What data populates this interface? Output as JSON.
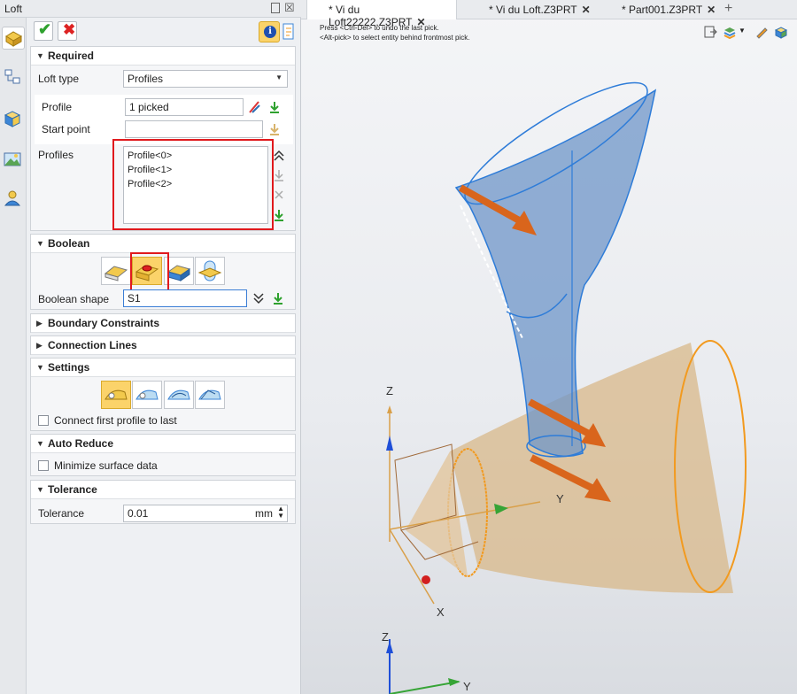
{
  "panel": {
    "title": "Loft",
    "pin_icon": "pin-icon",
    "close_glyph": "☒"
  },
  "actions": {
    "ok": "✔",
    "cancel": "✖",
    "info": "i"
  },
  "required": {
    "header": "Required",
    "loft_type_label": "Loft type",
    "loft_type_value": "Profiles",
    "profile_label": "Profile",
    "profile_value": "1 picked",
    "start_point_label": "Start point",
    "start_point_value": "",
    "profiles_label": "Profiles",
    "profiles_list": [
      "Profile<0>",
      "Profile<1>",
      "Profile<2>"
    ]
  },
  "boolean": {
    "header": "Boolean",
    "shape_label": "Boolean shape",
    "shape_value": "S1"
  },
  "boundary": {
    "header": "Boundary Constraints"
  },
  "connection": {
    "header": "Connection Lines"
  },
  "settings": {
    "header": "Settings",
    "connect_label": "Connect first profile to last"
  },
  "auto_reduce": {
    "header": "Auto Reduce",
    "minimize_label": "Minimize surface data"
  },
  "tolerance": {
    "header": "Tolerance",
    "label": "Tolerance",
    "value": "0.01",
    "unit": "mm"
  },
  "tabs": [
    {
      "label": "* Vi du Loft22222.Z3PRT",
      "close": "✕"
    },
    {
      "label": "* Vi du Loft.Z3PRT",
      "close": "✕"
    },
    {
      "label": "* Part001.Z3PRT",
      "close": "✕"
    }
  ],
  "add_tab": "+",
  "hints": {
    "line1": "Press <Ctrl-Del> to undo the last pick.",
    "line2": "<Alt-pick> to select entity behind frontmost pick."
  },
  "axes": {
    "z1": "Z",
    "x1": "X",
    "y1": "Y",
    "z2": "Z",
    "y2": "Y"
  },
  "colors": {
    "accent_highlight": "#fbd36a",
    "red_box": "#e0191d",
    "blue_surface": "#6f96c8",
    "tan_surface": "#d8b88a",
    "arrow_orange": "#d9651c"
  }
}
